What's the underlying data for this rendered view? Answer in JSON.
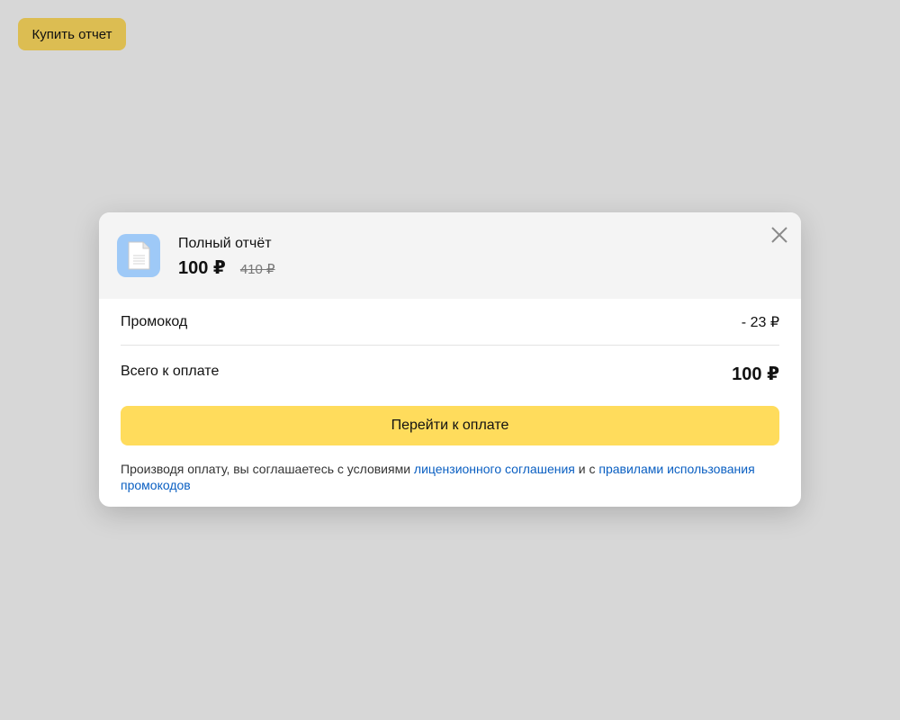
{
  "page": {
    "buy_button_label": "Купить отчет"
  },
  "modal": {
    "product_title": "Полный отчёт",
    "price_current": "100 ₽",
    "price_old": "410 ₽",
    "promo_label": "Промокод",
    "promo_value": "- 23 ₽",
    "total_label": "Всего к оплате",
    "total_value": "100 ₽",
    "pay_button_label": "Перейти к оплате",
    "terms_prefix": "Производя оплату, вы соглашаетесь с условиями ",
    "terms_link_license": "лицензионного соглашения",
    "terms_middle": " и с ",
    "terms_link_promo": "правилами использования промокодов"
  },
  "icons": {
    "product": "document-icon",
    "close": "close-icon"
  },
  "colors": {
    "background": "#d7d7d7",
    "buy_button": "#dcbd52",
    "pay_button": "#ffdc5c",
    "link": "#0a5fc2",
    "product_icon_bg": "#9ec9f7"
  }
}
